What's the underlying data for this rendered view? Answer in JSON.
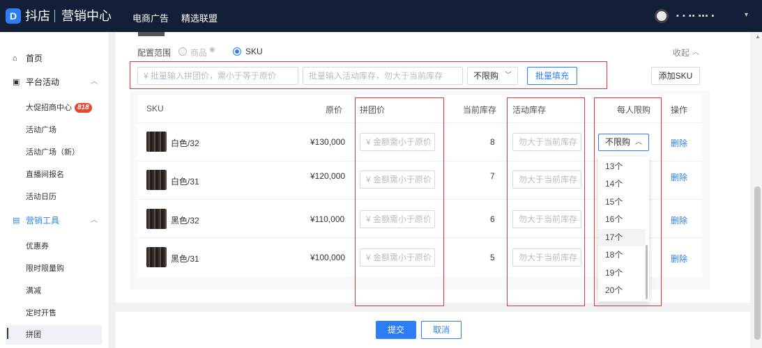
{
  "header": {
    "logo_glyph": "D",
    "brand": "抖店",
    "brand_sub": "营销中心",
    "nav": [
      "电商广告",
      "精选联盟"
    ],
    "user_name": "▪ ▪ ▪▪ ▪▪▪ ▪",
    "caret": "▾"
  },
  "sidebar": {
    "home": "首页",
    "platform": "平台活动",
    "platform_items": [
      "大促招商中心",
      "活动广场",
      "活动广场（新）",
      "直播间报名",
      "活动日历"
    ],
    "badge": "818",
    "tools": "营销工具",
    "tools_items": [
      "优惠券",
      "限时限量购",
      "满减",
      "定时开售",
      "拼团"
    ]
  },
  "config": {
    "label": "配置范围",
    "option_product": "商品",
    "option_sku": "SKU",
    "collapse": "收起"
  },
  "batch": {
    "price_placeholder": "¥ 批量输入拼团价，需小于等于原价",
    "stock_placeholder": "批量输入活动库存，勿大于当前库存",
    "limit_value": "不限购",
    "fill_button": "批量填充",
    "add_sku_button": "添加SKU"
  },
  "table": {
    "headers": [
      "SKU",
      "原价",
      "拼团价",
      "当前库存",
      "活动库存",
      "每人限购",
      "操作"
    ],
    "price_placeholder": "¥ 金额需小于原价",
    "stock_placeholder": "勿大于当前库存",
    "delete_label": "删除",
    "rows": [
      {
        "sku": "白色/32",
        "price": "¥130,000",
        "stock": "8"
      },
      {
        "sku": "白色/31",
        "price": "¥120,000",
        "stock": "7"
      },
      {
        "sku": "黑色/32",
        "price": "¥110,000",
        "stock": "6"
      },
      {
        "sku": "黑色/31",
        "price": "¥100,000",
        "stock": "5"
      }
    ]
  },
  "dropdown": {
    "selected": "不限购",
    "options": [
      "13个",
      "14个",
      "15个",
      "16个",
      "17个",
      "18个",
      "19个",
      "20个"
    ],
    "hovered_index": 4
  },
  "footer": {
    "submit": "提交",
    "cancel": "取消"
  },
  "colors": {
    "accent": "#2d7df6",
    "topbar": "#121f36",
    "highlight_box": "#d33a3a",
    "badge": "#e8462f"
  }
}
